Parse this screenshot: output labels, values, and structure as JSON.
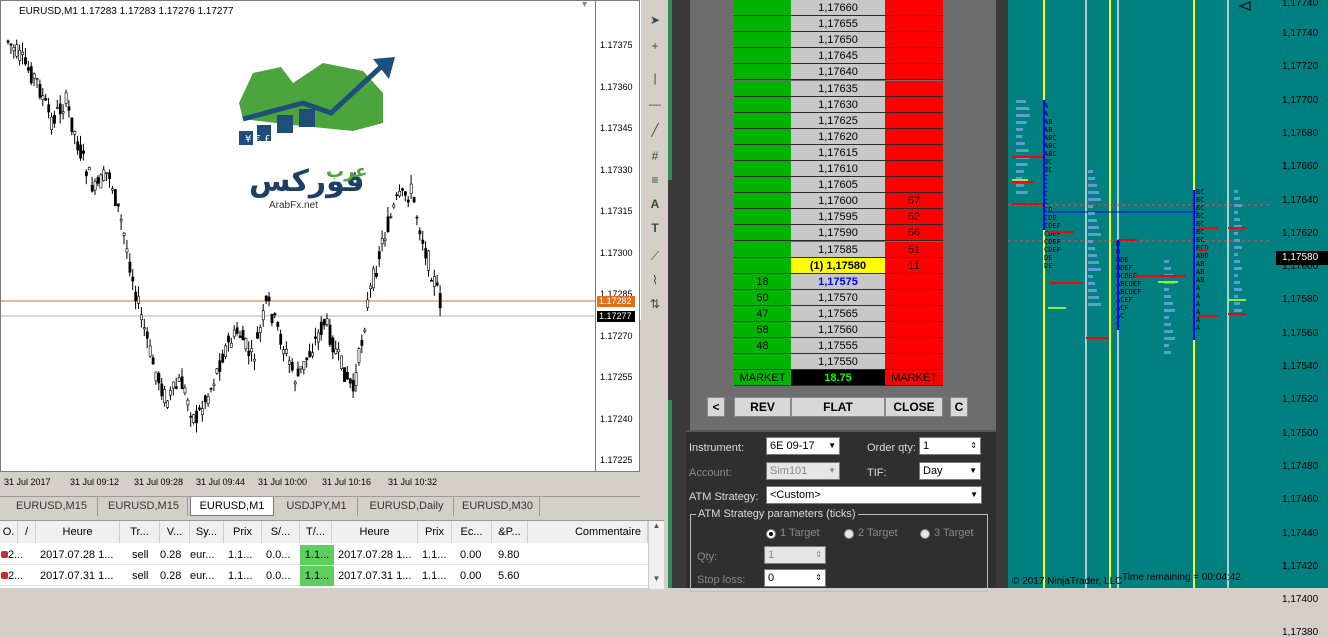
{
  "mt4": {
    "chart_header": "EURUSD,M1  1.17283 1.17283 1.17276 1.17277",
    "price_ticks": [
      "1.17375",
      "1.17360",
      "1.17345",
      "1.17330",
      "1.17315",
      "1.17300",
      "1.17285",
      "1.17270",
      "1.17255",
      "1.17240",
      "1.17225"
    ],
    "time_ticks": [
      "31 Jul 2017",
      "31 Jul 09:12",
      "31 Jul 09:28",
      "31 Jul 09:44",
      "31 Jul 10:00",
      "31 Jul 10:16",
      "31 Jul 10:32"
    ],
    "bid_tag": "1.17282",
    "last_tag": "1.17277",
    "logo_text": "فوركس عرب",
    "logo_url": "ArabFx.net",
    "tabs": [
      "EURUSD,M15",
      "EURUSD,M15",
      "EURUSD,M1",
      "USDJPY,M1",
      "EURUSD,Daily",
      "EURUSD,M30"
    ],
    "active_tab": 2,
    "terminal": {
      "headers": [
        "O.",
        "/",
        "Heure",
        "Tr...",
        "V...",
        "Sy...",
        "Prix",
        "S/...",
        "T/...",
        "Heure",
        "Prix",
        "Ec...",
        "&P...",
        "Commentaire"
      ],
      "rows": [
        [
          "2...",
          "2017.07.28 1...",
          "sell",
          "0.28",
          "eur...",
          "1.1...",
          "0.0...",
          "1.1...",
          "2017.07.28 1...",
          "1.1...",
          "0.00",
          "9.80"
        ],
        [
          "2...",
          "2017.07.31 1...",
          "sell",
          "0.28",
          "eur...",
          "1.1...",
          "0.0...",
          "1.1...",
          "2017.07.31 1...",
          "1.1...",
          "0.00",
          "5.60"
        ]
      ]
    }
  },
  "toolbar": {
    "icons": [
      "cursor-icon",
      "crosshair-icon",
      "vertical-line-icon",
      "horizontal-line-icon",
      "trendline-icon",
      "gann-icon",
      "fibo-icon",
      "text-icon",
      "label-icon",
      "fibo-fan-icon",
      "elliott-icon",
      "arrows-icon"
    ]
  },
  "dom": {
    "prices": [
      "1,17660",
      "1,17655",
      "1,17650",
      "1,17645",
      "1,17640",
      "1,17635",
      "1,17630",
      "1,17625",
      "1,17620",
      "1,17615",
      "1,17610",
      "1,17605",
      "1,17600",
      "1,17595",
      "1,17590",
      "1,17585",
      "(1) 1,17580",
      "1,17575",
      "1,17570",
      "1,17565",
      "1,17560",
      "1,17555",
      "1,17550"
    ],
    "ask": [
      "",
      "",
      "",
      "",
      "",
      "",
      "",
      "",
      "",
      "",
      "",
      "",
      "57",
      "52",
      "56",
      "51",
      "11",
      "",
      "",
      "",
      "",
      "",
      ""
    ],
    "bid": [
      "",
      "",
      "",
      "",
      "",
      "",
      "",
      "",
      "",
      "",
      "",
      "",
      "",
      "",
      "",
      "",
      "",
      "18",
      "50",
      "47",
      "58",
      "48",
      ""
    ],
    "market_left": "MARKET",
    "market_right": "MARKET",
    "pnl": "18.75",
    "btn_lt": "<",
    "btn_rev": "REV",
    "btn_flat": "FLAT",
    "btn_close": "CLOSE",
    "btn_c": "C"
  },
  "form": {
    "instrument_label": "Instrument:",
    "instrument": "6E 09-17",
    "order_qty_label": "Order qty:",
    "order_qty": "1",
    "account_label": "Account:",
    "account": "Sim101",
    "tif_label": "TIF:",
    "tif": "Day",
    "atm_label": "ATM Strategy:",
    "atm": "<Custom>",
    "group_title": "ATM Strategy parameters (ticks)",
    "target1": "1 Target",
    "target2": "2 Target",
    "target3": "3 Target",
    "qty_label": "Qty:",
    "qty": "1",
    "stop_label": "Stop loss:",
    "stop": "0"
  },
  "tpo": {
    "price_ticks": [
      "1,17740",
      "1,17720",
      "1,17700",
      "1,17680",
      "1,17660",
      "1,17640",
      "1,17620",
      "1,17600",
      "1,17580",
      "1,17560",
      "1,17540",
      "1,17520",
      "1,17500",
      "1,17480",
      "1,17460",
      "1,17440",
      "1,17420",
      "1,17400",
      "1,17380"
    ],
    "current_price": "1,17580",
    "copyright": "© 2017 NinjaTrader, LLC",
    "time_remaining": "Time remaining = 00:04:42",
    "top_tick": "1,17740"
  },
  "colors": {
    "green": "#00b400",
    "red": "#ff0000",
    "teal": "#008080",
    "yellow": "#ffff00"
  }
}
